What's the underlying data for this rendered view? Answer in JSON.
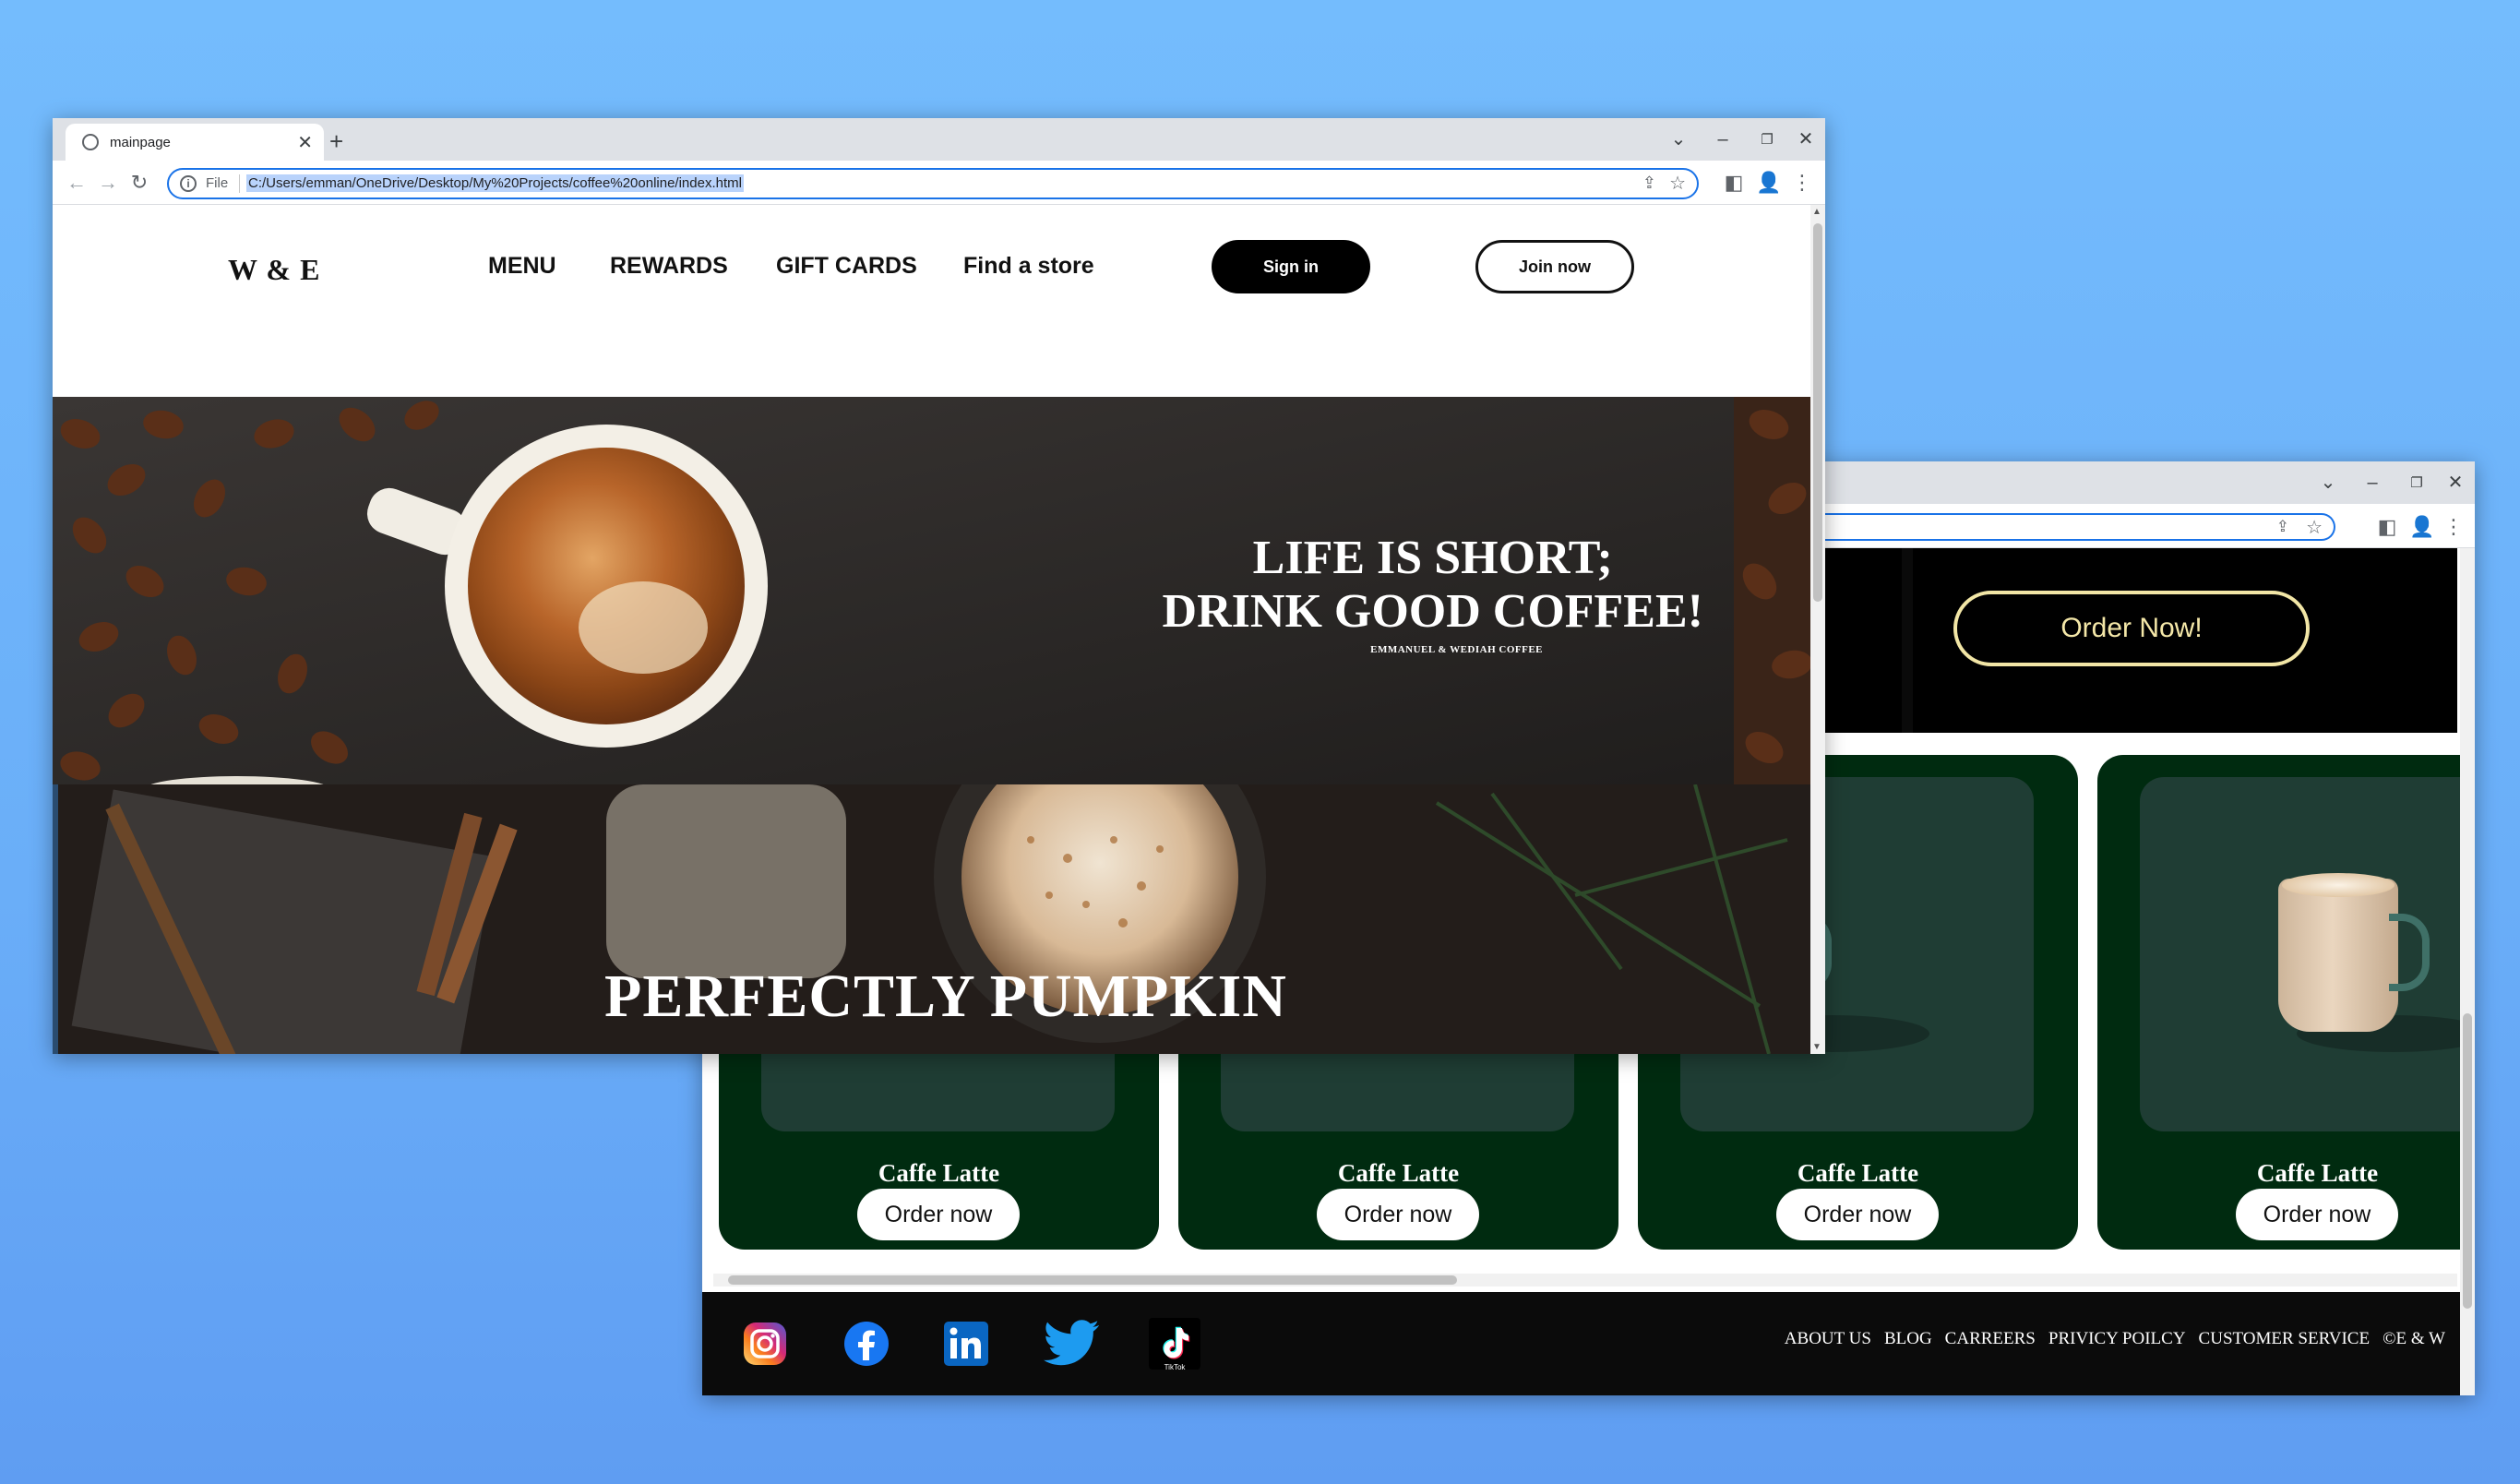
{
  "front_window": {
    "tab_title": "mainpage",
    "address": {
      "file_label": "File",
      "url": "C:/Users/emman/OneDrive/Desktop/My%20Projects/coffee%20online/index.html"
    },
    "site": {
      "logo": "W & E",
      "nav": [
        "MENU",
        "REWARDS",
        "GIFT CARDS",
        "Find a store"
      ],
      "sign_in": "Sign in",
      "join_now": "Join now",
      "hero_line1": "LIFE IS SHORT;",
      "hero_line2": "DRINK GOOD COFFEE!",
      "hero_sub": "EMMANUEL & WEDIAH COFFEE",
      "pumpkin_title": "PERFECTLY PUMPKIN"
    }
  },
  "back_window": {
    "order_now_big": "Order Now!",
    "cards": [
      {
        "name": "Caffe Latte",
        "button": "Order now"
      },
      {
        "name": "Caffe Latte",
        "button": "Order now"
      },
      {
        "name": "Caffe Latte",
        "button": "Order now"
      },
      {
        "name": "Caffe Latte",
        "button": "Order now"
      }
    ],
    "social_icons": [
      "instagram-icon",
      "facebook-icon",
      "linkedin-icon",
      "twitter-icon",
      "tiktok-icon"
    ],
    "tiktok_label": "TikTok",
    "footer_links": [
      "ABOUT US",
      "BLOG",
      "CARREERS",
      "PRIVICY POILCY",
      "CUSTOMER SERVICE",
      "©E & W"
    ]
  },
  "colors": {
    "desktop": "#74bcfd",
    "card_green": "#002b10",
    "order_border": "#f2e6a6",
    "chrome_blue": "#1a73e8"
  }
}
